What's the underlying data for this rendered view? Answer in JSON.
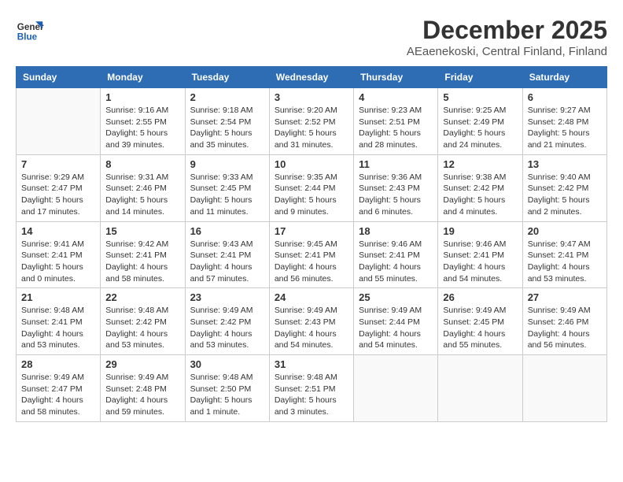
{
  "header": {
    "logo_line1": "General",
    "logo_line2": "Blue",
    "month": "December 2025",
    "location": "AEaenekoski, Central Finland, Finland"
  },
  "weekdays": [
    "Sunday",
    "Monday",
    "Tuesday",
    "Wednesday",
    "Thursday",
    "Friday",
    "Saturday"
  ],
  "weeks": [
    [
      {
        "day": "",
        "info": ""
      },
      {
        "day": "1",
        "info": "Sunrise: 9:16 AM\nSunset: 2:55 PM\nDaylight: 5 hours\nand 39 minutes."
      },
      {
        "day": "2",
        "info": "Sunrise: 9:18 AM\nSunset: 2:54 PM\nDaylight: 5 hours\nand 35 minutes."
      },
      {
        "day": "3",
        "info": "Sunrise: 9:20 AM\nSunset: 2:52 PM\nDaylight: 5 hours\nand 31 minutes."
      },
      {
        "day": "4",
        "info": "Sunrise: 9:23 AM\nSunset: 2:51 PM\nDaylight: 5 hours\nand 28 minutes."
      },
      {
        "day": "5",
        "info": "Sunrise: 9:25 AM\nSunset: 2:49 PM\nDaylight: 5 hours\nand 24 minutes."
      },
      {
        "day": "6",
        "info": "Sunrise: 9:27 AM\nSunset: 2:48 PM\nDaylight: 5 hours\nand 21 minutes."
      }
    ],
    [
      {
        "day": "7",
        "info": "Sunrise: 9:29 AM\nSunset: 2:47 PM\nDaylight: 5 hours\nand 17 minutes."
      },
      {
        "day": "8",
        "info": "Sunrise: 9:31 AM\nSunset: 2:46 PM\nDaylight: 5 hours\nand 14 minutes."
      },
      {
        "day": "9",
        "info": "Sunrise: 9:33 AM\nSunset: 2:45 PM\nDaylight: 5 hours\nand 11 minutes."
      },
      {
        "day": "10",
        "info": "Sunrise: 9:35 AM\nSunset: 2:44 PM\nDaylight: 5 hours\nand 9 minutes."
      },
      {
        "day": "11",
        "info": "Sunrise: 9:36 AM\nSunset: 2:43 PM\nDaylight: 5 hours\nand 6 minutes."
      },
      {
        "day": "12",
        "info": "Sunrise: 9:38 AM\nSunset: 2:42 PM\nDaylight: 5 hours\nand 4 minutes."
      },
      {
        "day": "13",
        "info": "Sunrise: 9:40 AM\nSunset: 2:42 PM\nDaylight: 5 hours\nand 2 minutes."
      }
    ],
    [
      {
        "day": "14",
        "info": "Sunrise: 9:41 AM\nSunset: 2:41 PM\nDaylight: 5 hours\nand 0 minutes."
      },
      {
        "day": "15",
        "info": "Sunrise: 9:42 AM\nSunset: 2:41 PM\nDaylight: 4 hours\nand 58 minutes."
      },
      {
        "day": "16",
        "info": "Sunrise: 9:43 AM\nSunset: 2:41 PM\nDaylight: 4 hours\nand 57 minutes."
      },
      {
        "day": "17",
        "info": "Sunrise: 9:45 AM\nSunset: 2:41 PM\nDaylight: 4 hours\nand 56 minutes."
      },
      {
        "day": "18",
        "info": "Sunrise: 9:46 AM\nSunset: 2:41 PM\nDaylight: 4 hours\nand 55 minutes."
      },
      {
        "day": "19",
        "info": "Sunrise: 9:46 AM\nSunset: 2:41 PM\nDaylight: 4 hours\nand 54 minutes."
      },
      {
        "day": "20",
        "info": "Sunrise: 9:47 AM\nSunset: 2:41 PM\nDaylight: 4 hours\nand 53 minutes."
      }
    ],
    [
      {
        "day": "21",
        "info": "Sunrise: 9:48 AM\nSunset: 2:41 PM\nDaylight: 4 hours\nand 53 minutes."
      },
      {
        "day": "22",
        "info": "Sunrise: 9:48 AM\nSunset: 2:42 PM\nDaylight: 4 hours\nand 53 minutes."
      },
      {
        "day": "23",
        "info": "Sunrise: 9:49 AM\nSunset: 2:42 PM\nDaylight: 4 hours\nand 53 minutes."
      },
      {
        "day": "24",
        "info": "Sunrise: 9:49 AM\nSunset: 2:43 PM\nDaylight: 4 hours\nand 54 minutes."
      },
      {
        "day": "25",
        "info": "Sunrise: 9:49 AM\nSunset: 2:44 PM\nDaylight: 4 hours\nand 54 minutes."
      },
      {
        "day": "26",
        "info": "Sunrise: 9:49 AM\nSunset: 2:45 PM\nDaylight: 4 hours\nand 55 minutes."
      },
      {
        "day": "27",
        "info": "Sunrise: 9:49 AM\nSunset: 2:46 PM\nDaylight: 4 hours\nand 56 minutes."
      }
    ],
    [
      {
        "day": "28",
        "info": "Sunrise: 9:49 AM\nSunset: 2:47 PM\nDaylight: 4 hours\nand 58 minutes."
      },
      {
        "day": "29",
        "info": "Sunrise: 9:49 AM\nSunset: 2:48 PM\nDaylight: 4 hours\nand 59 minutes."
      },
      {
        "day": "30",
        "info": "Sunrise: 9:48 AM\nSunset: 2:50 PM\nDaylight: 5 hours\nand 1 minute."
      },
      {
        "day": "31",
        "info": "Sunrise: 9:48 AM\nSunset: 2:51 PM\nDaylight: 5 hours\nand 3 minutes."
      },
      {
        "day": "",
        "info": ""
      },
      {
        "day": "",
        "info": ""
      },
      {
        "day": "",
        "info": ""
      }
    ]
  ]
}
